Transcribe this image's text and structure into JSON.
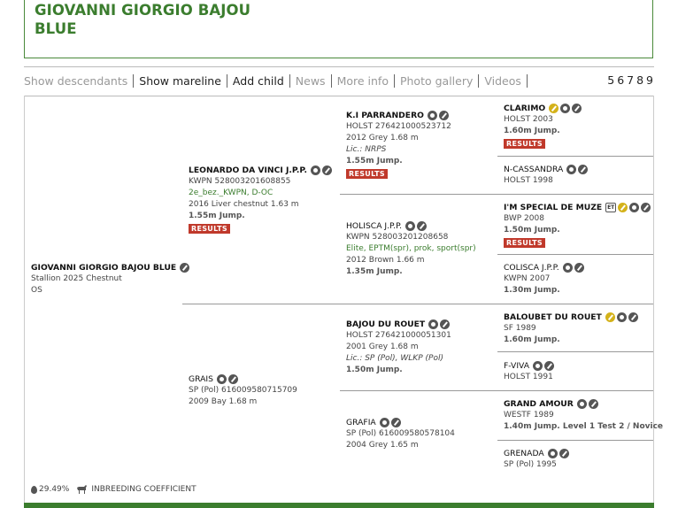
{
  "title": "GIOVANNI GIORGIO BAJOU BLUE",
  "nav": {
    "items": [
      {
        "label": "Show descendants",
        "style": "muted"
      },
      {
        "label": "Show mareline",
        "style": "dark"
      },
      {
        "label": "Add child",
        "style": "dark"
      },
      {
        "label": "News",
        "style": "muted"
      },
      {
        "label": "More info",
        "style": "muted"
      },
      {
        "label": "Photo gallery",
        "style": "muted"
      },
      {
        "label": "Videos",
        "style": "muted"
      }
    ],
    "pages": [
      "5",
      "6",
      "7",
      "8",
      "9"
    ]
  },
  "subject": {
    "name": "GIOVANNI GIORGIO BAJOU BLUE",
    "line1": "Stallion 2025 Chestnut",
    "line2": "OS"
  },
  "sire": {
    "name": "LEONARDO DA VINCI J.P.P.",
    "reg": "KWPN 528003201608855",
    "pred": "2e_bez._KWPN, D-OC",
    "desc": "2016 Liver chestnut 1.63 m",
    "perf": "1.55m Jump.",
    "results": "RESULTS"
  },
  "dam": {
    "name": "GRAIS",
    "reg": "SP (Pol) 616009580715709",
    "desc": "2009 Bay 1.68 m"
  },
  "ss": {
    "name": "K.I PARRANDERO",
    "reg": "HOLST 276421000523712",
    "desc": "2012 Grey 1.68 m",
    "lic": "Lic.: NRPS",
    "perf": "1.55m Jump.",
    "results": "RESULTS"
  },
  "sd": {
    "name": "HOLISCA J.P.P.",
    "reg": "KWPN 528003201208658",
    "pred": "Elite, EPTM(spr), prok, sport(spr)",
    "desc": "2012 Brown 1.66 m",
    "perf": "1.35m Jump."
  },
  "ds": {
    "name": "BAJOU DU ROUET",
    "reg": "HOLST 276421000051301",
    "desc": "2001 Grey 1.68 m",
    "lic": "Lic.: SP (Pol), WLKP (Pol)",
    "perf": "1.50m Jump."
  },
  "dd": {
    "name": "GRAFIA",
    "reg": "SP (Pol) 616009580578104",
    "desc": "2004 Grey 1.65 m"
  },
  "sss": {
    "name": "CLARIMO",
    "reg": "HOLST 2003",
    "perf": "1.60m Jump.",
    "results": "RESULTS"
  },
  "ssd": {
    "name": "N-CASSANDRA",
    "reg": "HOLST 1998"
  },
  "sds": {
    "name": "I'M SPECIAL DE MUZE",
    "reg": "BWP 2008",
    "perf": "1.50m Jump.",
    "results": "RESULTS",
    "et": "ET"
  },
  "sdd": {
    "name": "COLISCA J.P.P.",
    "reg": "KWPN 2007",
    "perf": "1.30m Jump."
  },
  "dss": {
    "name": "BALOUBET DU ROUET",
    "reg": "SF 1989",
    "perf": "1.60m Jump."
  },
  "dsd": {
    "name": "F-VIVA",
    "reg": "HOLST 1991"
  },
  "dds": {
    "name": "GRAND AMOUR",
    "reg": "WESTF 1989",
    "perf": "1.40m Jump. Level 1 Test 2 / Novice"
  },
  "ddd": {
    "name": "GRENADA",
    "reg": "SP (Pol) 1995"
  },
  "footer": {
    "percent": "29.49%",
    "label": "INBREEDING COEFFICIENT"
  },
  "colors": {
    "brand_green": "#3b7d2e",
    "results_red": "#c0392b",
    "gold": "#d4b21a"
  }
}
